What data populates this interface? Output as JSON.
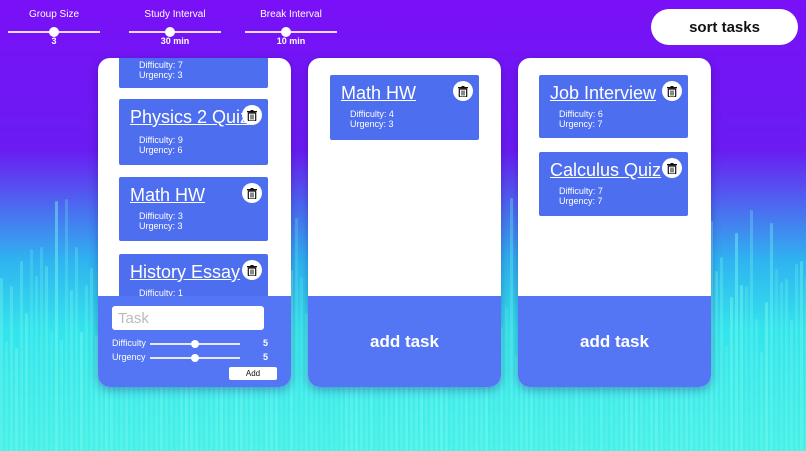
{
  "header": {
    "group_size": {
      "label": "Group Size",
      "value": "3",
      "level": 0.5
    },
    "study_interval": {
      "label": "Study Interval",
      "value": "30 min",
      "level": 0.45
    },
    "break_interval": {
      "label": "Break Interval",
      "value": "10 min",
      "level": 0.45
    },
    "sort_label": "sort tasks"
  },
  "columns": [
    {
      "tasks": [
        {
          "title": "",
          "difficulty": "Difficulty: 7",
          "urgency": "Urgency: 3"
        },
        {
          "title": "Physics 2 Quiz",
          "difficulty": "Difficulty: 9",
          "urgency": "Urgency: 6"
        },
        {
          "title": "Math HW",
          "difficulty": "Difficulty: 3",
          "urgency": "Urgency: 3"
        },
        {
          "title": "History Essay",
          "difficulty": "Difficulty: 1",
          "urgency": ""
        }
      ],
      "form": {
        "task_placeholder": "Task",
        "difficulty_label": "Difficulty",
        "difficulty_value": "5",
        "difficulty_level": 0.5,
        "urgency_label": "Urgency",
        "urgency_value": "5",
        "urgency_level": 0.5,
        "add_label": "Add"
      }
    },
    {
      "tasks": [
        {
          "title": "Math HW",
          "difficulty": "Difficulty: 4",
          "urgency": "Urgency: 3"
        }
      ],
      "add_task_label": "add task"
    },
    {
      "tasks": [
        {
          "title": "Job Interview",
          "difficulty": "Difficulty: 6",
          "urgency": "Urgency: 7"
        },
        {
          "title": "Calculus Quiz",
          "difficulty": "Difficulty: 7",
          "urgency": "Urgency: 7"
        }
      ],
      "add_task_label": "add task"
    }
  ],
  "icons": {
    "trash": "trash-icon"
  },
  "colors": {
    "card": "#4e6ef0",
    "footer": "#5576f4",
    "background_top": "#7a10f7",
    "background_bottom": "#48f0e6"
  }
}
